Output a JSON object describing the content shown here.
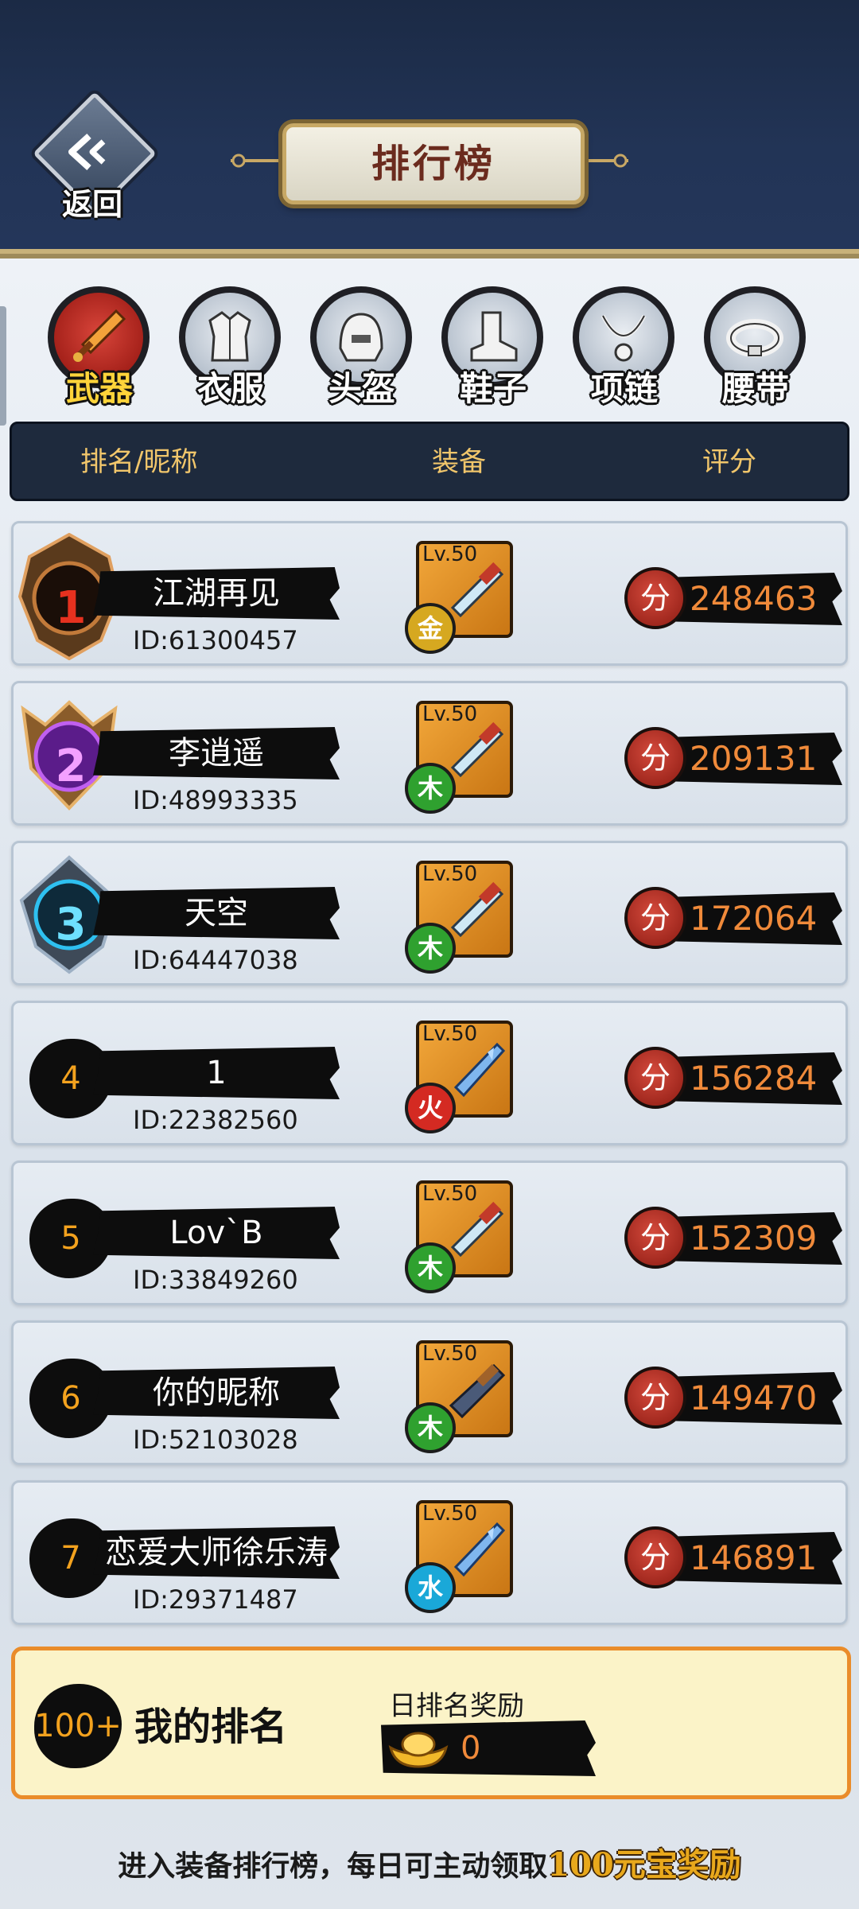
{
  "header": {
    "back_label": "返回",
    "title": "排行榜"
  },
  "tabs": [
    {
      "label": "武器",
      "icon": "sword-icon",
      "active": true
    },
    {
      "label": "衣服",
      "icon": "armor-icon",
      "active": false
    },
    {
      "label": "头盔",
      "icon": "helmet-icon",
      "active": false
    },
    {
      "label": "鞋子",
      "icon": "boot-icon",
      "active": false
    },
    {
      "label": "项链",
      "icon": "necklace-icon",
      "active": false
    },
    {
      "label": "腰带",
      "icon": "belt-icon",
      "active": false
    }
  ],
  "columns": {
    "rank_name": "排名/昵称",
    "equipment": "装备",
    "score": "评分"
  },
  "rows": [
    {
      "rank": "1",
      "name": "江湖再见",
      "id": "ID:61300457",
      "level": "Lv.50",
      "element": "金",
      "score": "248463"
    },
    {
      "rank": "2",
      "name": "李逍遥",
      "id": "ID:48993335",
      "level": "Lv.50",
      "element": "木",
      "score": "209131"
    },
    {
      "rank": "3",
      "name": "天空",
      "id": "ID:64447038",
      "level": "Lv.50",
      "element": "木",
      "score": "172064"
    },
    {
      "rank": "4",
      "name": "1",
      "id": "ID:22382560",
      "level": "Lv.50",
      "element": "火",
      "score": "156284"
    },
    {
      "rank": "5",
      "name": "Lov`B",
      "id": "ID:33849260",
      "level": "Lv.50",
      "element": "木",
      "score": "152309"
    },
    {
      "rank": "6",
      "name": "你的昵称",
      "id": "ID:52103028",
      "level": "Lv.50",
      "element": "木",
      "score": "149470"
    },
    {
      "rank": "7",
      "name": "恋爱大师徐乐涛",
      "id": "ID:29371487",
      "level": "Lv.50",
      "element": "水",
      "score": "146891"
    }
  ],
  "score_icon_label": "分",
  "my_rank": {
    "rank": "100+",
    "label": "我的排名",
    "reward_title": "日排名奖励",
    "reward_value": "0"
  },
  "footer": {
    "text": "进入装备排行榜，每日可主动领取",
    "highlight": "100元宝奖励"
  },
  "colors": {
    "header_bg": "#1b2a45",
    "accent_gold": "#f1c66b",
    "score_orange": "#f08a3a",
    "element_gold": "#d6a820",
    "element_wood": "#2fa12f",
    "element_fire": "#d42a22",
    "element_water": "#1aa8d8"
  }
}
